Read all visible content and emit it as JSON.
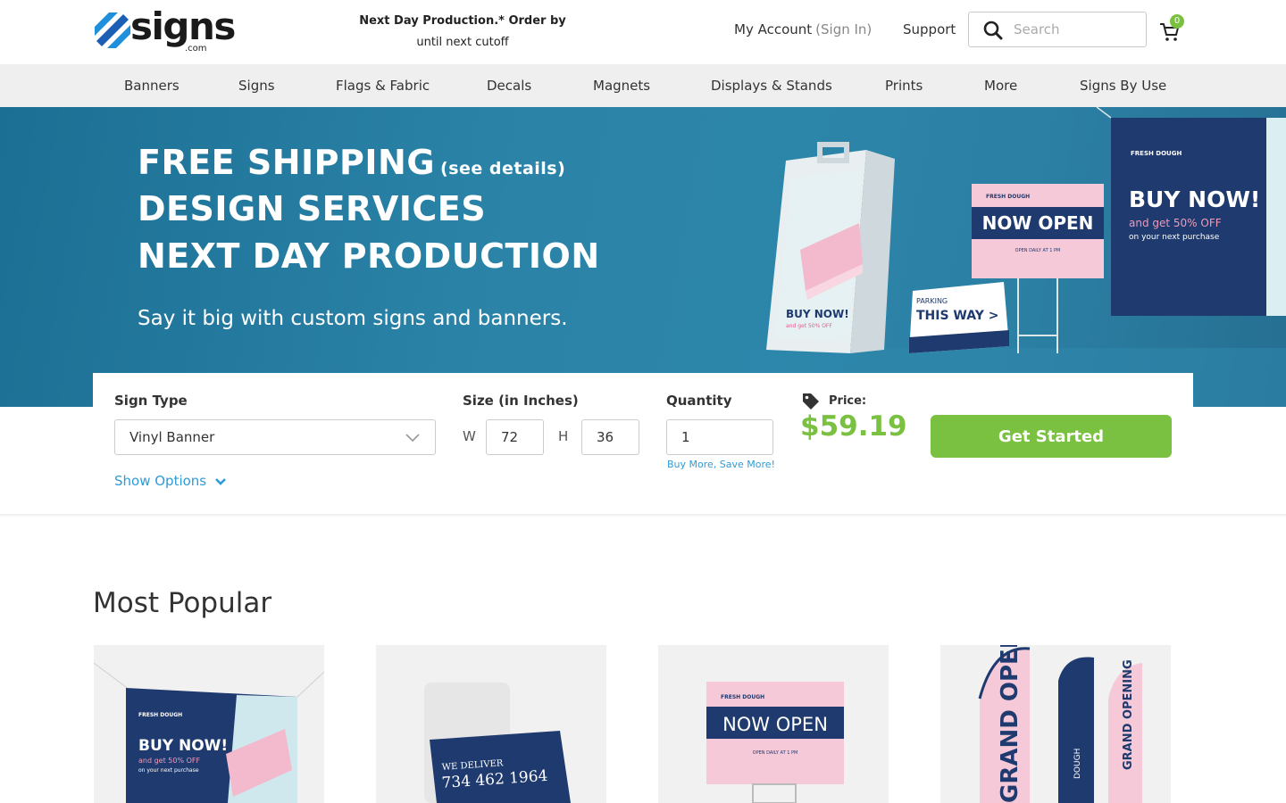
{
  "header": {
    "logo_text": "signs",
    "logo_suffix": ".com",
    "promo_line1": "Next Day Production.* Order by",
    "promo_line2": "until next cutoff",
    "account_label": "My Account",
    "signin_label": "(Sign In)",
    "support_label": "Support",
    "search_placeholder": "Search",
    "cart_count": "0"
  },
  "nav": {
    "items": [
      "Banners",
      "Signs",
      "Flags & Fabric",
      "Decals",
      "Magnets",
      "Displays & Stands",
      "Prints",
      "More",
      "Signs By Use"
    ]
  },
  "hero": {
    "line1": "FREE SHIPPING",
    "line1_link": "(see details)",
    "line2": "DESIGN SERVICES",
    "line3": "NEXT DAY PRODUCTION",
    "subtitle": "Say it big with custom signs and banners.",
    "art": {
      "brand": "FRESH DOUGH",
      "aframe_text": "BUY NOW!",
      "aframe_sub": "and get 50% OFF",
      "yard_sign": "NOW OPEN",
      "yard_sub": "OPEN DAILY AT 1 PM",
      "parking_top": "PARKING",
      "parking_main": "THIS WAY >",
      "banner_title": "BUY NOW!",
      "banner_sub1": "and get 50% OFF",
      "banner_sub2": "on your next purchase"
    }
  },
  "configurator": {
    "sign_type_label": "Sign Type",
    "sign_type_value": "Vinyl Banner",
    "show_options": "Show Options",
    "size_label": "Size (in Inches)",
    "width_letter": "W",
    "width_value": "72",
    "height_letter": "H",
    "height_value": "36",
    "quantity_label": "Quantity",
    "quantity_value": "1",
    "buy_more": "Buy More, Save More!",
    "price_label": "Price:",
    "price_value": "$59.19",
    "cta": "Get Started"
  },
  "popular": {
    "title": "Most Popular",
    "cards": [
      {
        "t1": "BUY NOW!",
        "t2": "and get 50% OFF",
        "t3": "on your next purchase",
        "brand": "FRESH DOUGH"
      },
      {
        "t1": "WE DELIVER",
        "t2": "734 462 1964"
      },
      {
        "t1": "NOW OPEN",
        "t2": "OPEN DAILY AT 1 PM",
        "brand": "FRESH DOUGH"
      },
      {
        "t1": "GRAND OPENING",
        "t2": "DOUGH",
        "t3": "GRAND OPENING"
      }
    ]
  },
  "colors": {
    "accent_green": "#7ac142",
    "link_blue": "#2e9bd6",
    "navy": "#1f3a6e",
    "pink": "#f6c9d9",
    "hero_blue": "#2b84a8"
  }
}
